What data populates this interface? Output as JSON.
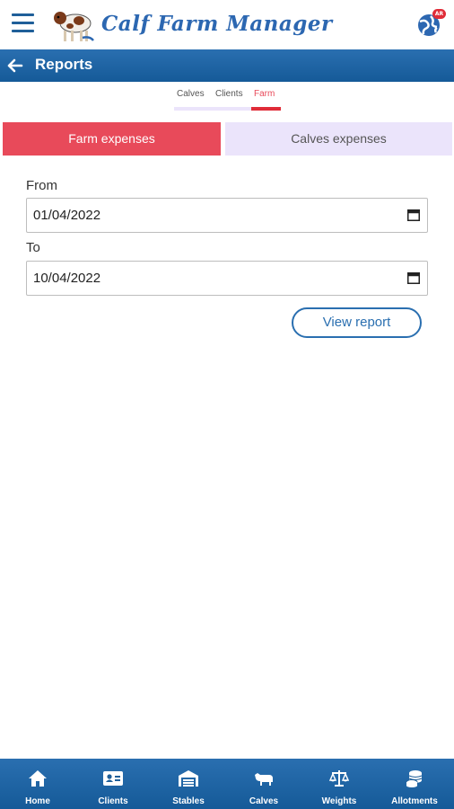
{
  "app": {
    "title": "Calf Farm Manager",
    "badge": "AR"
  },
  "header": {
    "title": "Reports"
  },
  "subtabs": [
    {
      "label": "Calves"
    },
    {
      "label": "Clients"
    },
    {
      "label": "Farm",
      "active": true
    }
  ],
  "segments": {
    "left": "Farm expenses",
    "right": "Calves expenses"
  },
  "form": {
    "from_label": "From",
    "from_value": "01/04/2022",
    "to_label": "To",
    "to_value": "10/04/2022",
    "view_button": "View report"
  },
  "bottom_nav": [
    {
      "label": "Home",
      "icon": "home-icon"
    },
    {
      "label": "Clients",
      "icon": "id-card-icon"
    },
    {
      "label": "Stables",
      "icon": "warehouse-icon"
    },
    {
      "label": "Calves",
      "icon": "cow-icon"
    },
    {
      "label": "Weights",
      "icon": "scale-icon"
    },
    {
      "label": "Allotments",
      "icon": "coins-icon"
    }
  ],
  "colors": {
    "primary": "#2a6fb0",
    "accent": "#e84a5a",
    "inactive_segment": "#ebe4fb"
  }
}
